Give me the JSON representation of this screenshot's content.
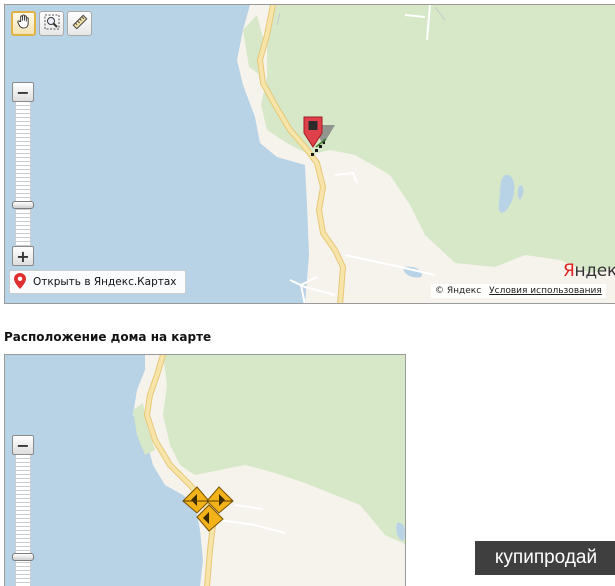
{
  "map_top": {
    "open_yandex_label": "Открыть в Яндекс.Картах",
    "logo_ya": "Я",
    "logo_rest": "ндекс",
    "copyright": "© Яндекс",
    "terms_link": "Условия использования",
    "tools": [
      "hand-icon",
      "zoom-rectangle-icon",
      "ruler-icon"
    ],
    "colors": {
      "water": "#b9d3e6",
      "forest": "#d6e8c8",
      "land": "#f6f3ec",
      "road": "#f3dc9c",
      "marker": "#e0404a"
    }
  },
  "map_bottom": {
    "section_title": "Расположение дома на карте"
  },
  "watermark": {
    "text": "купипродай"
  }
}
